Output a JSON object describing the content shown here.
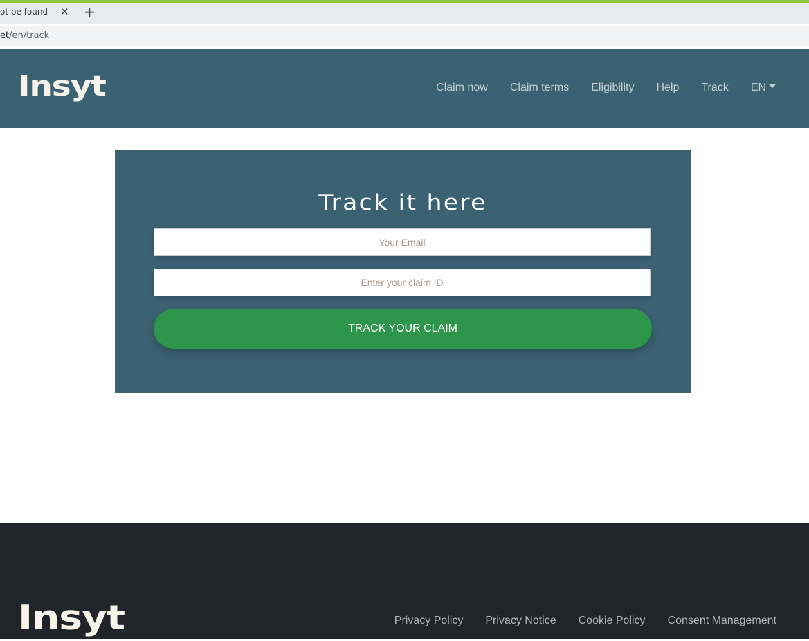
{
  "browser": {
    "tab_title": "ot be found",
    "tab_close_glyph": "✕",
    "new_tab_glyph": "+",
    "url_host_part": "et",
    "url_path": "/en/track",
    "accent_color": "#8cc63f"
  },
  "header": {
    "logo": "Insyt",
    "nav": [
      {
        "label": "Claim now"
      },
      {
        "label": "Claim terms"
      },
      {
        "label": "Eligibility"
      },
      {
        "label": "Help"
      },
      {
        "label": "Track"
      }
    ],
    "language": "EN",
    "background_color": "#3b6272"
  },
  "track": {
    "title": "Track it here",
    "email_placeholder": "Your Email",
    "email_value": "",
    "claim_id_placeholder": "Enter your claim ID",
    "claim_id_value": "",
    "button_label": "TRACK YOUR CLAIM",
    "button_color": "#2e964a"
  },
  "footer": {
    "logo": "Insyt",
    "links": [
      {
        "label": "Privacy Policy"
      },
      {
        "label": "Privacy Notice"
      },
      {
        "label": "Cookie Policy"
      },
      {
        "label": "Consent Management"
      }
    ],
    "background_color": "#212429"
  }
}
